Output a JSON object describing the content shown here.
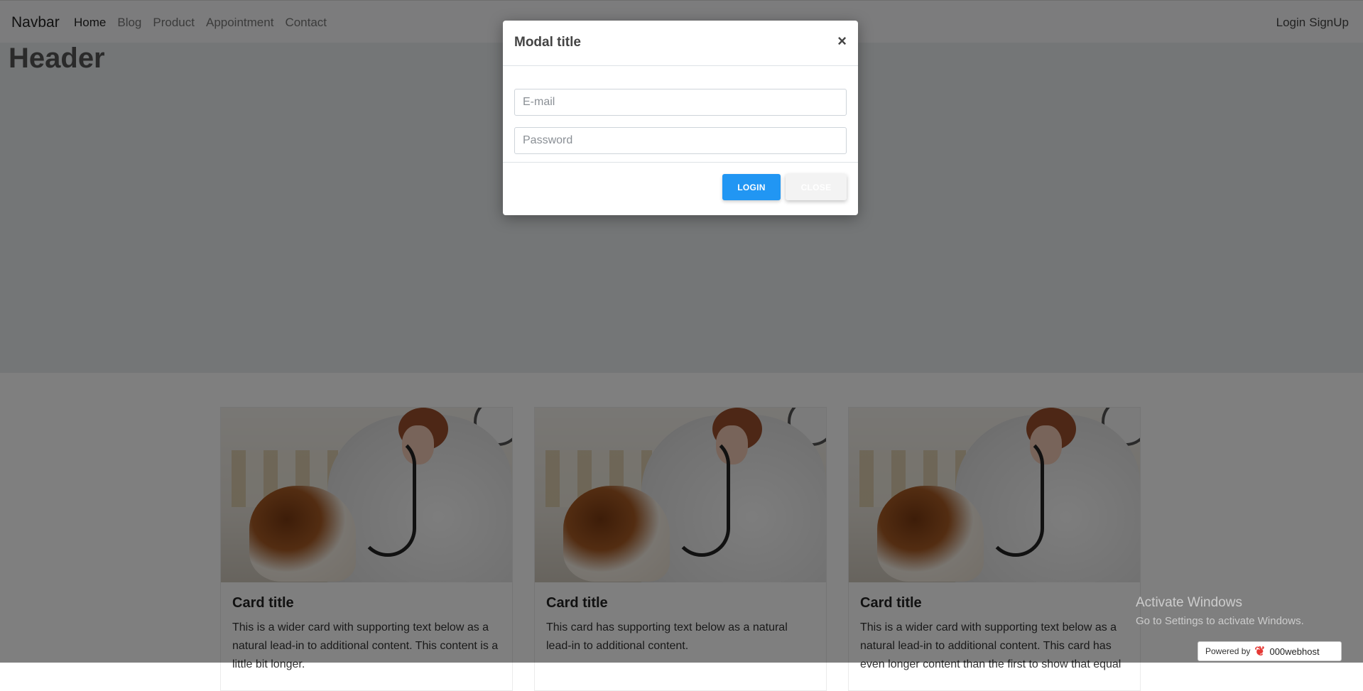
{
  "navbar": {
    "brand": "Navbar",
    "links": [
      "Home",
      "Blog",
      "Product",
      "Appointment",
      "Contact"
    ],
    "login": "Login",
    "signup": "SignUp"
  },
  "header": {
    "title": "Header"
  },
  "cards": [
    {
      "title": "Card title",
      "text": "This is a wider card with supporting text below as a natural lead-in to additional content. This content is a little bit longer."
    },
    {
      "title": "Card title",
      "text": "This card has supporting text below as a natural lead-in to additional content."
    },
    {
      "title": "Card title",
      "text": "This is a wider card with supporting text below as a natural lead-in to additional content. This card has even longer content than the first to show that equal"
    }
  ],
  "modal": {
    "title": "Modal title",
    "close_icon": "×",
    "email_placeholder": "E-mail",
    "password_placeholder": "Password",
    "login_label": "LOGIN",
    "close_label": "CLOSE"
  },
  "watermark": {
    "line1": "Activate Windows",
    "line2": "Go to Settings to activate Windows."
  },
  "badge": {
    "powered_by": "Powered by",
    "brand": "000webhost"
  },
  "colors": {
    "primary": "#2196f3",
    "overlay": "rgba(0,0,0,0.5)"
  }
}
